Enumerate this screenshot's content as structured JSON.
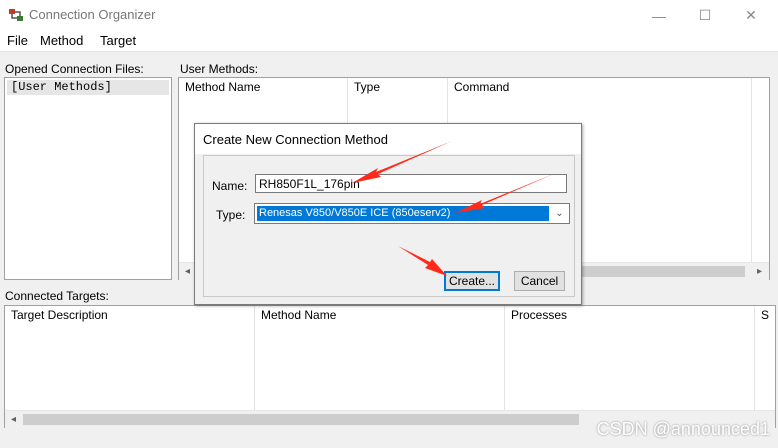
{
  "window": {
    "title": "Connection Organizer",
    "controls": {
      "minimize": "—",
      "maximize": "☐",
      "close": "✕"
    }
  },
  "menu": [
    "File",
    "Method",
    "Target"
  ],
  "opened_files": {
    "label": "Opened Connection Files:",
    "items": [
      "[User Methods]"
    ]
  },
  "user_methods": {
    "label": "User Methods:",
    "columns": [
      "Method Name",
      "Type",
      "Command"
    ]
  },
  "connected_targets": {
    "label": "Connected Targets:",
    "columns": [
      "Target Description",
      "Method Name",
      "Processes",
      "S"
    ]
  },
  "dialog": {
    "title": "Create New Connection Method",
    "name_label": "Name:",
    "name_value": "RH850F1L_176pin",
    "type_label": "Type:",
    "type_value": "Renesas V850/V850E ICE (850eserv2)",
    "create_label": "Create...",
    "cancel_label": "Cancel"
  },
  "watermark": "CSDN @announced1",
  "colors": {
    "selection": "#0078d7",
    "arrow_annotation": "#ff2a1a"
  },
  "icons": {
    "app": "app-connection-icon",
    "scroll_left": "◂",
    "scroll_right": "▸",
    "dropdown": "⌄"
  }
}
